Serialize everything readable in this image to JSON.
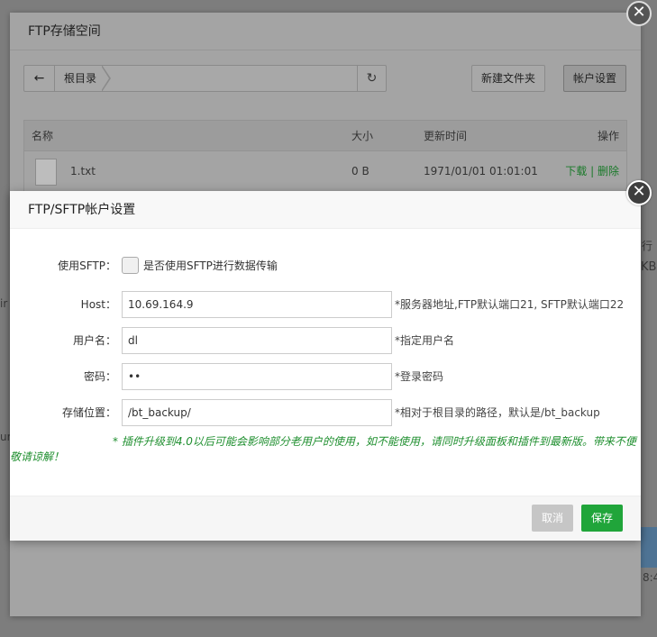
{
  "background": {
    "frag_right_top": "行",
    "frag_right_kb": "KB",
    "frag_left_in": "ir",
    "frag_left_ur": "ur",
    "frag_right_time": "8:4"
  },
  "outer_dialog": {
    "title": "FTP存储空间",
    "toolbar": {
      "back_icon": "arrow-left-icon",
      "breadcrumb_root": "根目录",
      "refresh_icon": "refresh-icon",
      "new_folder_label": "新建文件夹",
      "account_settings_label": "帐户设置"
    },
    "table": {
      "headers": {
        "name": "名称",
        "size": "大小",
        "time": "更新时间",
        "op": "操作"
      },
      "rows": [
        {
          "name": "1.txt",
          "size": "0 B",
          "time": "1971/01/01 01:01:01",
          "download": "下载",
          "sep": " | ",
          "delete": "删除"
        }
      ]
    }
  },
  "modal": {
    "title": "FTP/SFTP帐户设置",
    "sftp": {
      "label": "使用SFTP：",
      "checkbox_label": "是否使用SFTP进行数据传输",
      "checked": false
    },
    "host": {
      "label": "Host：",
      "value": "10.69.164.9",
      "hint": "*服务器地址,FTP默认端口21, SFTP默认端口22"
    },
    "username": {
      "label": "用户名：",
      "value": "dl",
      "hint": "*指定用户名"
    },
    "password": {
      "label": "密码：",
      "value": "••",
      "hint": "*登录密码"
    },
    "path": {
      "label": "存储位置：",
      "value": "/bt_backup/",
      "hint": "*相对于根目录的路径，默认是/bt_backup"
    },
    "notice": "* 插件升级到4.0以后可能会影响部分老用户的使用，如不能使用，请同时升级面板和插件到最新版。带来不便敬请谅解！",
    "cancel_label": "取消",
    "save_label": "保存"
  },
  "colors": {
    "accent": "#20a53a",
    "link": "#1a7a2a",
    "notice": "#1f8f2f"
  }
}
